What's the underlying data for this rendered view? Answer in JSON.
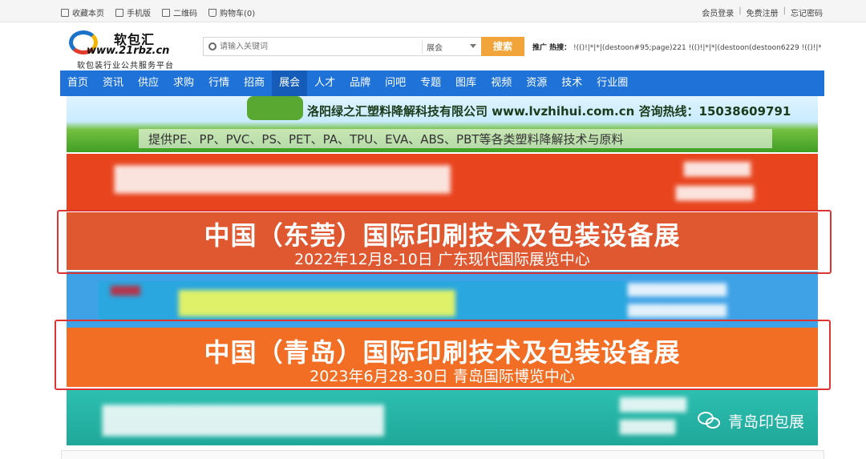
{
  "topbar": {
    "favorite": "收藏本页",
    "mobile": "手机版",
    "qrcode": "二维码",
    "cart": "购物车(0)",
    "login": "会员登录",
    "register": "免费注册",
    "forgot": "忘记密码"
  },
  "logo": {
    "name": "软包汇",
    "url": "www.21rbz.cn",
    "slogan": "软包装行业公共服务平台"
  },
  "search": {
    "placeholder": "请输入关键词",
    "category": "展会",
    "button": "搜索",
    "hot_label": "推广 热搜：",
    "hot_text": "!(()!|*|*|(destoon#95;page)221  !(()!|*|*|(destoon(destoon6229  !(()!|*|"
  },
  "nav": {
    "items": [
      "首页",
      "资讯",
      "供应",
      "求购",
      "行情",
      "招商",
      "展会",
      "人才",
      "品牌",
      "问吧",
      "专题",
      "图库",
      "视频",
      "资源",
      "技术",
      "行业圈"
    ],
    "active_index": 6
  },
  "banners": {
    "green": {
      "company": "洛阳绿之汇塑料降解科技有限公司   www.lvzhihui.com.cn  咨询热线：15038609791",
      "desc": "提供PE、PP、PVC、PS、PET、PA、TPU、EVA、ABS、PBT等各类塑料降解技术与原料"
    },
    "dongguan": {
      "title": "中国（东莞）国际印刷技术及包装设备展",
      "subtitle": "2022年12月8-10日   广东现代国际展览中心"
    },
    "qingdao": {
      "title": "中国（青岛）国际印刷技术及包装设备展",
      "subtitle": "2023年6月28-30日       青岛国际博览中心"
    },
    "watermark": "青岛印包展"
  }
}
